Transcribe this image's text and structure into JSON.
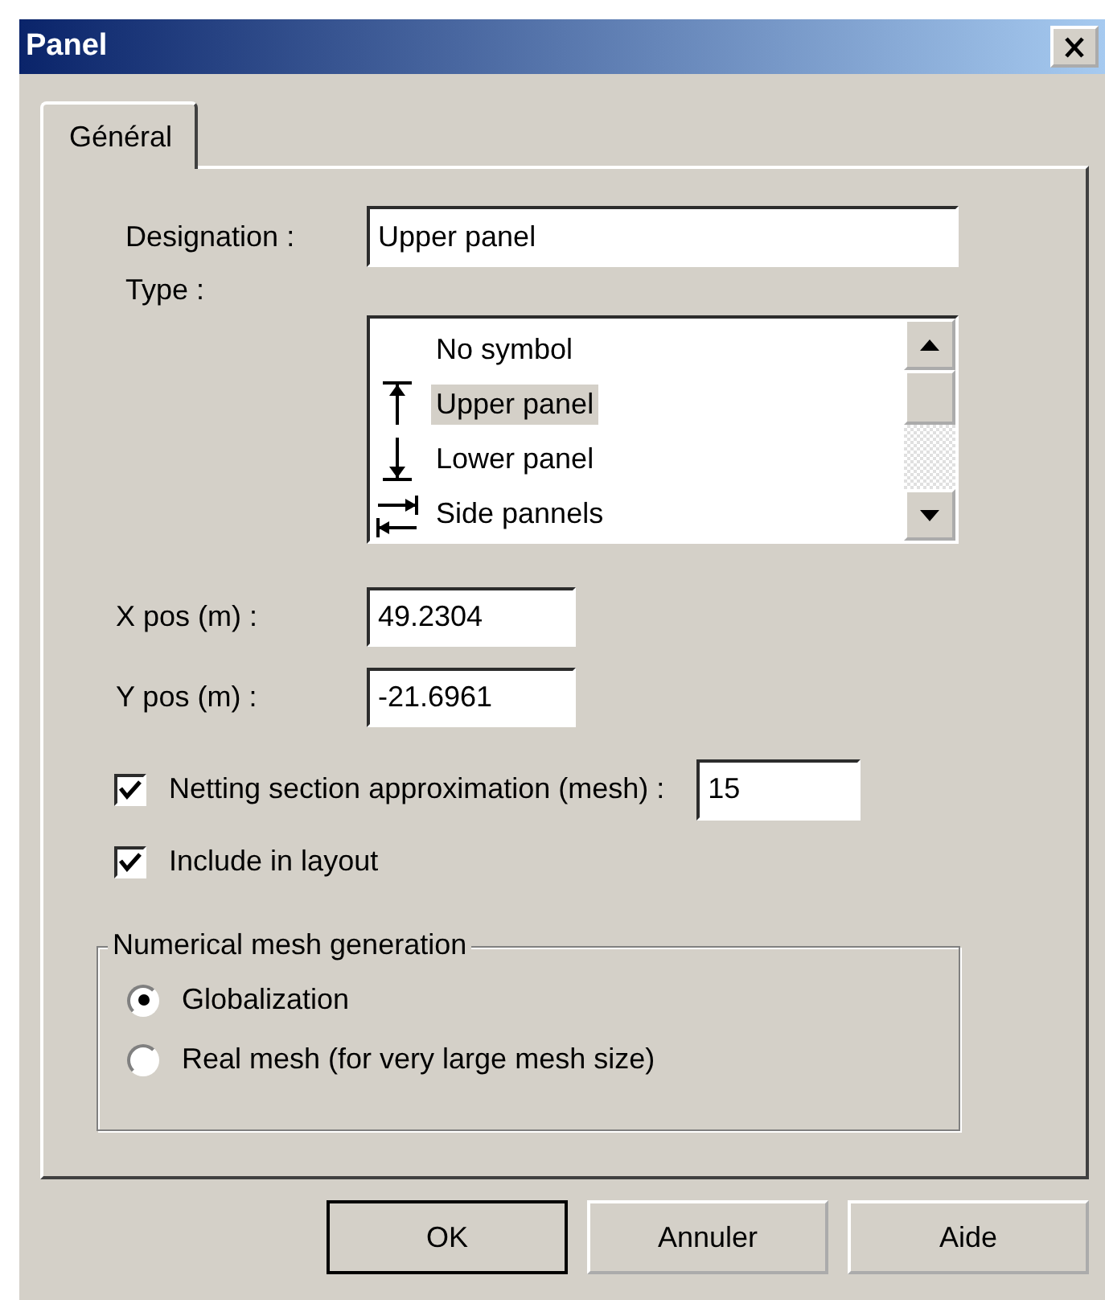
{
  "window": {
    "title": "Panel"
  },
  "tabs": [
    {
      "label": "Général",
      "selected": true
    }
  ],
  "designation": {
    "label": "Designation :",
    "value": "Upper panel"
  },
  "type": {
    "label": "Type :",
    "items": [
      {
        "label": "No symbol",
        "kind": "none",
        "selected": false
      },
      {
        "label": "Upper panel",
        "kind": "upper",
        "selected": true
      },
      {
        "label": "Lower panel",
        "kind": "lower",
        "selected": false
      },
      {
        "label": "Side pannels",
        "kind": "side",
        "selected": false
      }
    ]
  },
  "x_pos": {
    "label": "X pos (m) :",
    "value": "49.2304"
  },
  "y_pos": {
    "label": "Y pos (m) :",
    "value": "-21.6961"
  },
  "checkboxes": [
    {
      "label": "Netting section approximation (mesh) :",
      "checked": true,
      "value": "15"
    },
    {
      "label": "Include in layout",
      "checked": true
    }
  ],
  "mesh_group": {
    "title": "Numerical mesh generation",
    "options": [
      {
        "label": "Globalization",
        "selected": true
      },
      {
        "label": "Real mesh (for very large mesh size)",
        "selected": false
      }
    ]
  },
  "buttons": [
    {
      "label": "OK",
      "default": true
    },
    {
      "label": "Annuler",
      "default": false
    },
    {
      "label": "Aide",
      "default": false
    }
  ]
}
